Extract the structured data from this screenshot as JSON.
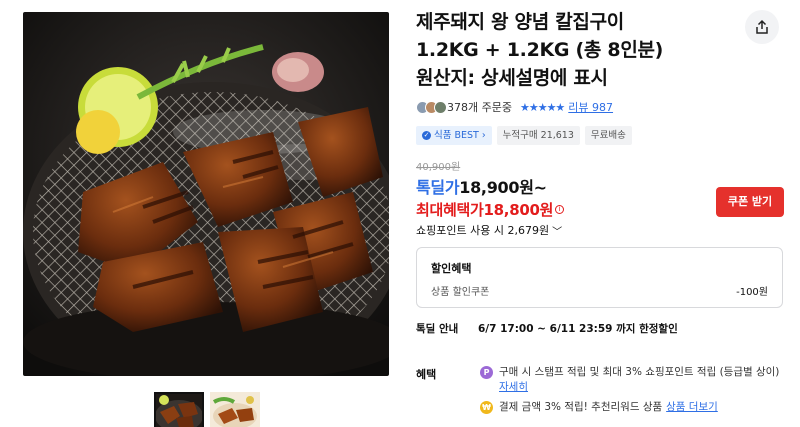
{
  "product": {
    "title_line1": "제주돼지 왕 양념 칼집구이",
    "title_line2": "1.2KG + 1.2KG (총 8인분)",
    "title_line3": "원산지: 상세설명에 표시",
    "image_alt": "grilled marinated pork on wire grill"
  },
  "share": {
    "icon": "share-icon"
  },
  "reviews": {
    "order_count": "378개 주문중",
    "stars": "★★★★★",
    "rating": 5,
    "review_label": "리뷰 987"
  },
  "badges": {
    "best": "식품 BEST",
    "cumulative": "누적구매 21,613",
    "shipping": "무료배송"
  },
  "price": {
    "original": "40,900원",
    "deal_label": "톡딜가",
    "deal_price": "18,900원~",
    "max_label": "최대혜택가",
    "max_price": "18,800원",
    "info_icon": "i"
  },
  "coupon": {
    "label": "쿠폰 받기"
  },
  "points": {
    "label": "쇼핑포인트 사용 시 2,679원",
    "chevron": "﹀"
  },
  "discount": {
    "title": "할인혜택",
    "item": "상품 할인쿠폰",
    "amount": "-100원"
  },
  "special": {
    "label": "톡딜 안내",
    "text": "6/7 17:00 ~ 6/11 23:59 까지 한정할인"
  },
  "benefits": {
    "label": "혜택",
    "b1_text": "구매 시 스탬프 적립 및 최대 3% 쇼핑포인트 적립 (등급별 상이)",
    "b1_link": "자세히",
    "b2_text": "결제 금액 3% 적립! 추천리워드 상품",
    "b2_link": "상품 더보기",
    "b1_icon": "P",
    "b2_icon": "₩"
  },
  "colors": {
    "accent_blue": "#2f6fe5",
    "accent_red": "#e31c1c",
    "coupon_red": "#e5312c"
  }
}
